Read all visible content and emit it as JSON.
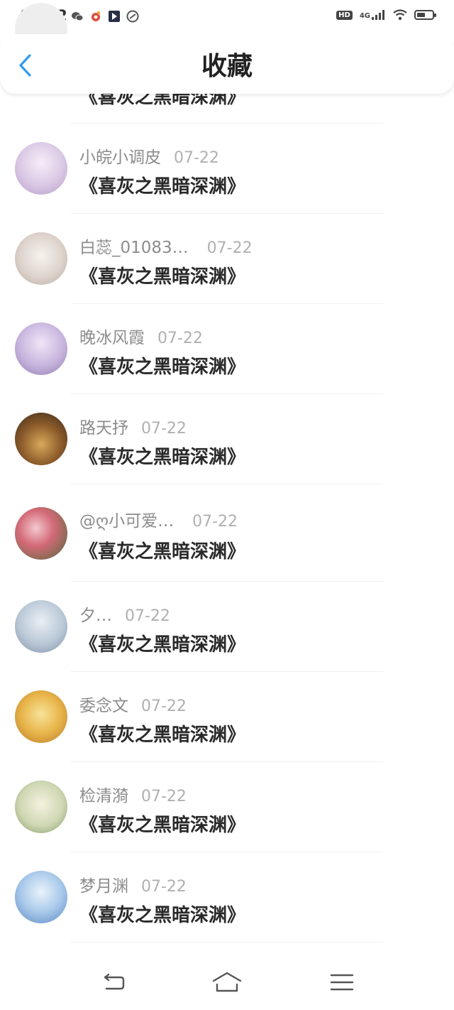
{
  "status_bar": {
    "time": "02:22",
    "hd": "HD",
    "network": "4G",
    "battery_level": 0.55,
    "left_icons": [
      "wechat-icon",
      "weibo-icon",
      "video-app-icon",
      "link-app-icon"
    ]
  },
  "header": {
    "title": "收藏",
    "back_icon": "chevron-left-icon",
    "accent": "#2f9bf0"
  },
  "list": {
    "partial_title": "《喜灰之黑暗深渊》",
    "items": [
      {
        "username": "小皖小调皮",
        "date": "07-22",
        "title": "《喜灰之黑暗深渊》"
      },
      {
        "username": "白蕊_01083…",
        "date": "07-22",
        "title": "《喜灰之黑暗深渊》"
      },
      {
        "username": "晚冰风霞",
        "date": "07-22",
        "title": "《喜灰之黑暗深渊》"
      },
      {
        "username": "路天抒",
        "date": "07-22",
        "title": "《喜灰之黑暗深渊》"
      },
      {
        "username": "@ღ小可爱…",
        "date": "07-22",
        "title": "《喜灰之黑暗深渊》"
      },
      {
        "username": "夕…",
        "date": "07-22",
        "title": "《喜灰之黑暗深渊》"
      },
      {
        "username": "委念文",
        "date": "07-22",
        "title": "《喜灰之黑暗深渊》"
      },
      {
        "username": "检清漪",
        "date": "07-22",
        "title": "《喜灰之黑暗深渊》"
      },
      {
        "username": "梦月渊",
        "date": "07-22",
        "title": "《喜灰之黑暗深渊》"
      }
    ]
  },
  "bottom_nav": {
    "icons": [
      "back-nav-icon",
      "home-nav-icon",
      "menu-nav-icon"
    ]
  }
}
